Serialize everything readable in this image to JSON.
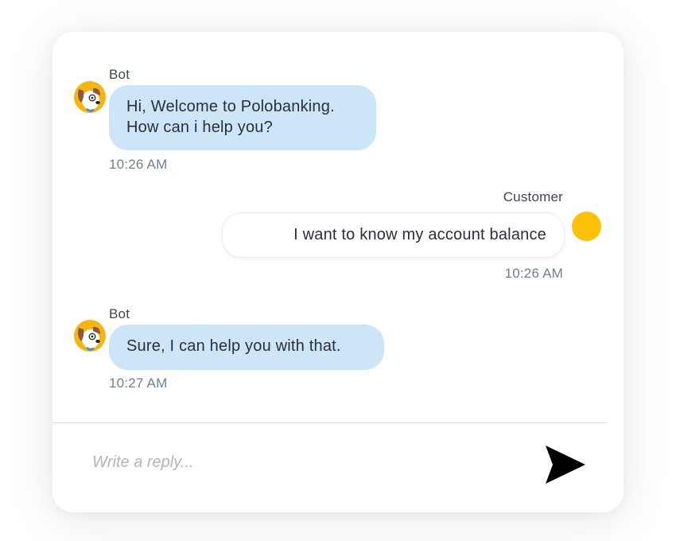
{
  "messages": [
    {
      "sender": "Bot",
      "lines": [
        "Hi, Welcome to Polobanking.",
        "How can i help you?"
      ],
      "time": "10:26 AM",
      "avatar_icon": "dog-avatar-icon"
    },
    {
      "sender": "Customer",
      "text": "I want to know my account balance",
      "time": "10:26 AM",
      "avatar_color": "#ffc107"
    },
    {
      "sender": "Bot",
      "text": "Sure, I can help you with that.",
      "time": "10:27 AM",
      "avatar_icon": "dog-avatar-icon"
    }
  ],
  "composer": {
    "placeholder": "Write a reply...",
    "send_icon": "send-icon"
  },
  "colors": {
    "bot_bubble": "#cce6f8",
    "customer_avatar": "#ffc107",
    "timestamp": "#6f7f92"
  }
}
